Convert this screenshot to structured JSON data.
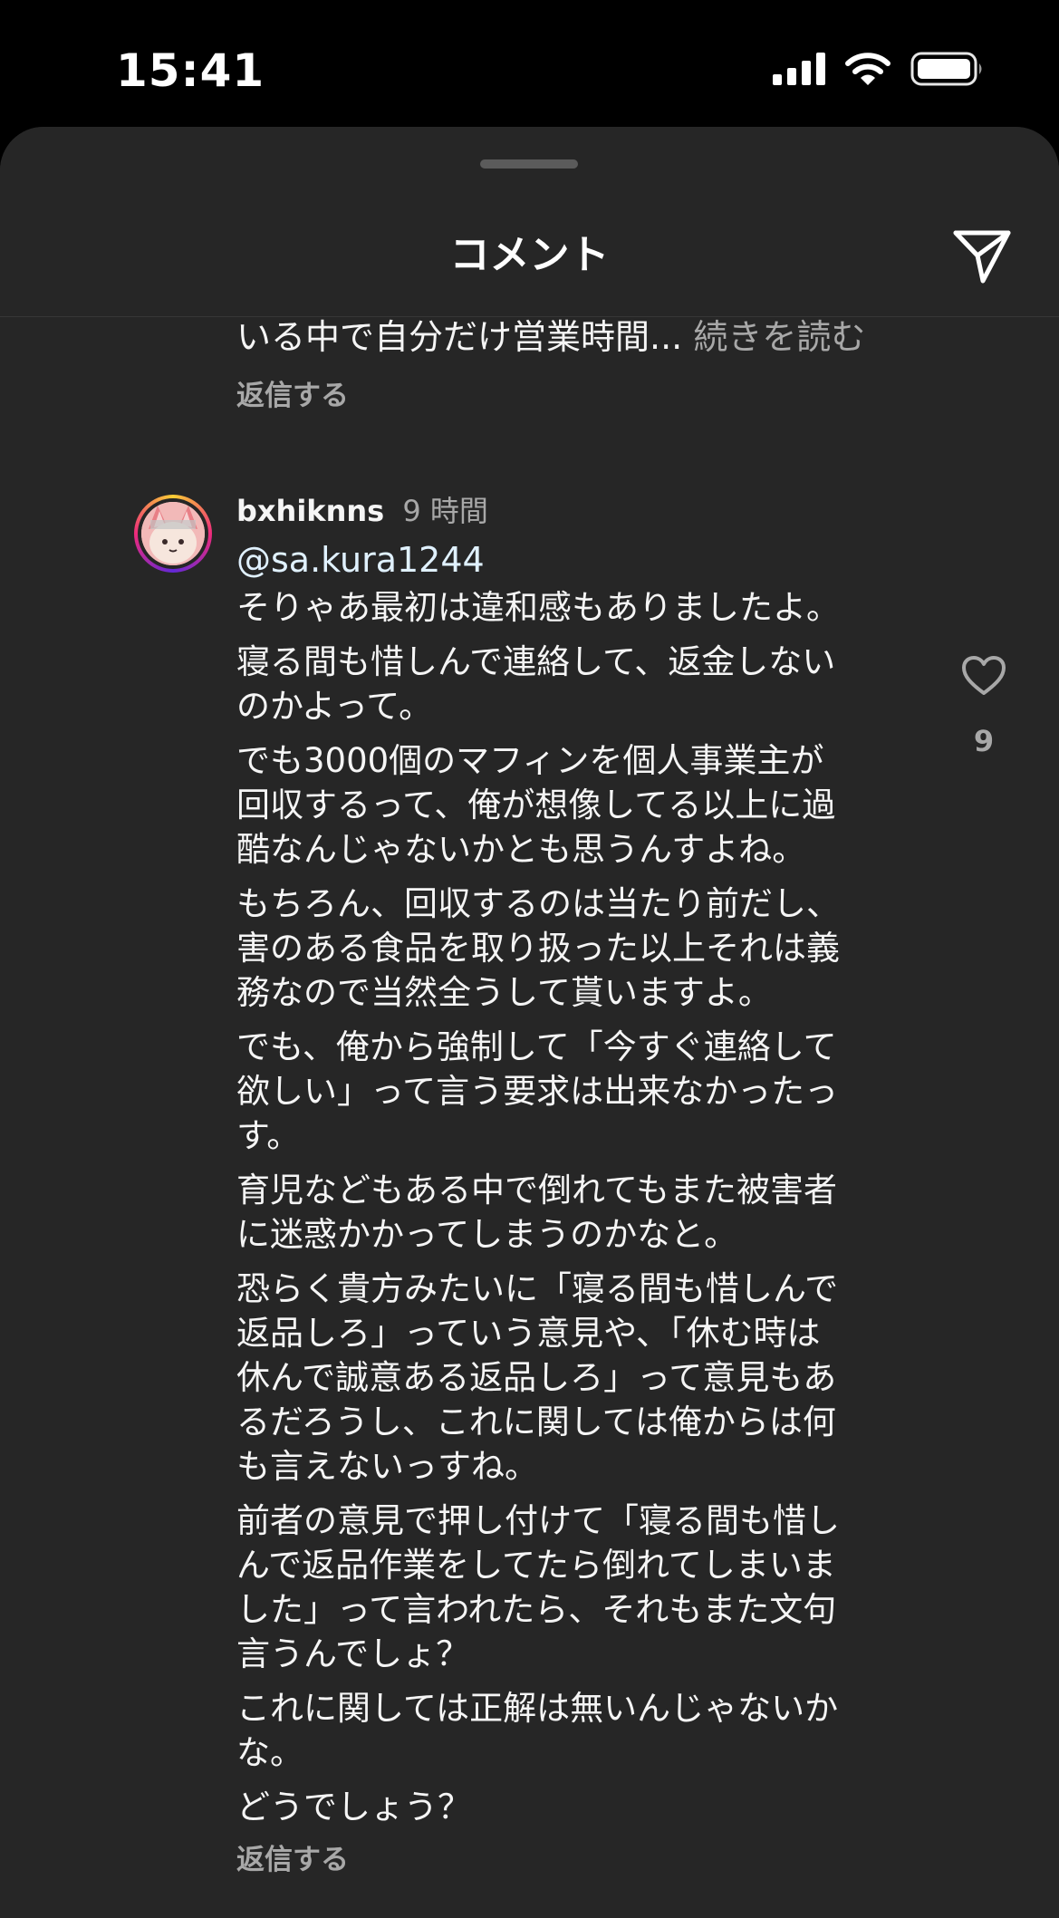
{
  "status_bar": {
    "time": "15:41",
    "icons": [
      "signal-icon",
      "wifi-icon",
      "battery-icon"
    ]
  },
  "sheet": {
    "title": "コメント",
    "share_icon": "paper-plane-icon"
  },
  "previous_comment": {
    "truncated_text": "いる中で自分だけ営業時間...",
    "read_more": "続きを読む",
    "reply": "返信する"
  },
  "comment": {
    "username": "bxhiknns",
    "time": "9 時間",
    "mention": "@sa.kura1244",
    "paragraphs": [
      "そりゃあ最初は違和感もありましたよ。",
      "寝る間も惜しんで連絡して、返金しない\nのかよって。",
      "でも3000個のマフィンを個人事業主が\n回収するって、俺が想像してる以上に過\n酷なんじゃないかとも思うんすよね。",
      "もちろん、回収するのは当たり前だし、\n害のある食品を取り扱った以上それは義\n務なので当然全うして貰いますよ。",
      "でも、俺から強制して「今すぐ連絡して\n欲しい」って言う要求は出来なかったっ\nす。",
      "育児などもある中で倒れてもまた被害者\nに迷惑かかってしまうのかなと。",
      "恐らく貴方みたいに「寝る間も惜しんで\n返品しろ」っていう意見や、「休む時は\n休んで誠意ある返品しろ」って意見もあ\nるだろうし、これに関しては俺からは何\nも言えないっすね。",
      "前者の意見で押し付けて「寝る間も惜し\nんで返品作業をしてたら倒れてしまいま\nした」って言われたら、それもまた文句\n言うんでしょ？",
      "これに関しては正解は無いんじゃないか\nな。",
      "どうでしょう？"
    ],
    "reply": "返信する",
    "like_icon": "heart-outline-icon",
    "like_count": "9"
  },
  "colors": {
    "sheet_bg": "#262626",
    "secondary_text": "#a8a8a8",
    "primary_text": "#f5f5f5"
  }
}
